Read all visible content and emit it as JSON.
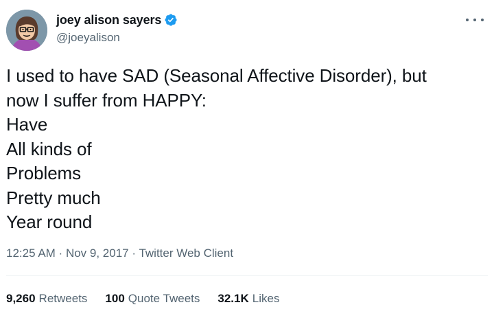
{
  "author": {
    "display_name": "joey alison sayers",
    "handle": "@joeyalison",
    "verified": true,
    "verified_color": "#1d9bf0"
  },
  "tweet": {
    "lines": [
      "I used to have SAD (Seasonal Affective Disorder), but",
      "now I suffer from HAPPY:",
      "Have",
      "All kinds of",
      "Problems",
      "Pretty much",
      "Year round"
    ],
    "time": "12:25 AM",
    "date": "Nov 9, 2017",
    "client": "Twitter Web Client",
    "separator": " · "
  },
  "stats": {
    "retweets": {
      "count": "9,260",
      "label": "Retweets"
    },
    "quote_tweets": {
      "count": "100",
      "label": "Quote Tweets"
    },
    "likes": {
      "count": "32.1K",
      "label": "Likes"
    }
  },
  "icons": {
    "more": "more-icon",
    "verified": "verified-badge-icon"
  }
}
